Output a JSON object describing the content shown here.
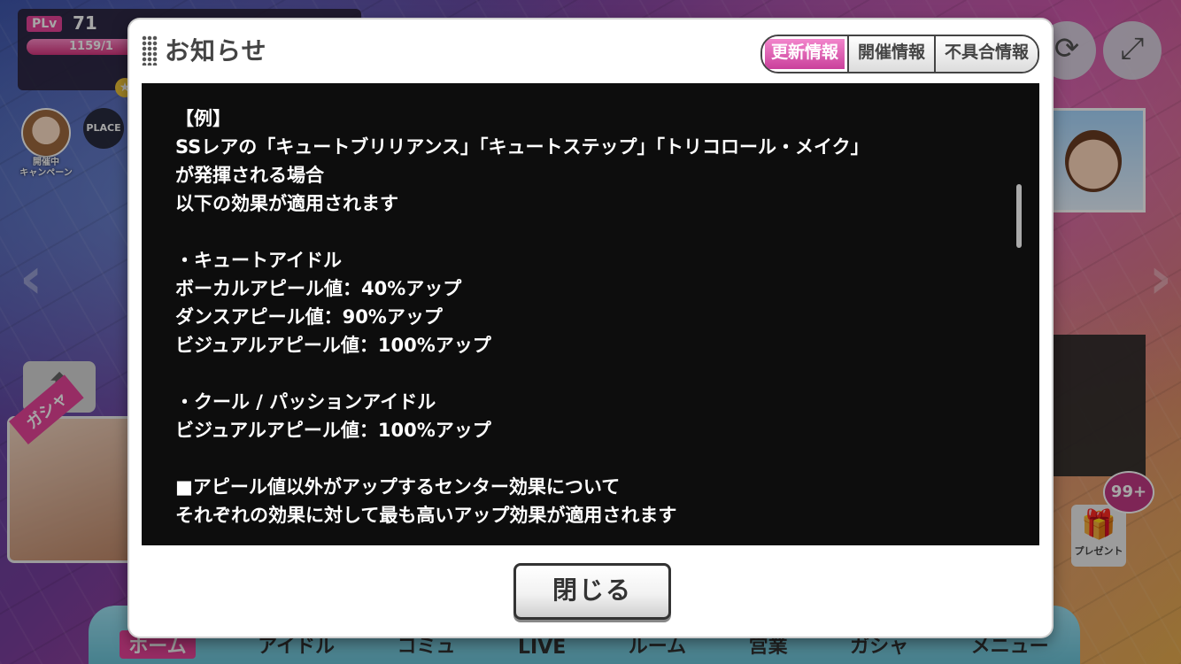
{
  "background": {
    "player_level_badge": "PLv",
    "player_level": "71",
    "exp_text": "1159/1",
    "exp_progress": 0.9,
    "campaign_label": "開催中\nキャンペーン",
    "place_label": "PLACE",
    "gacha_label": "ガシャ",
    "present_label": "プレゼント",
    "present_badge": "99+",
    "footer": [
      "ホーム",
      "アイドル",
      "コミュ",
      "LIVE",
      "ルーム",
      "営業",
      "ガシャ",
      "メニュー"
    ]
  },
  "modal": {
    "title": "お知らせ",
    "tabs": [
      {
        "label": "更新情報",
        "active": true
      },
      {
        "label": "開催情報",
        "active": false
      },
      {
        "label": "不具合情報",
        "active": false
      }
    ],
    "content_lines": [
      "【例】",
      "SSレアの「キュートブリリアンス」「キュートステップ」「トリコロール・メイク」",
      "が発揮される場合",
      "以下の効果が適用されます",
      "",
      "・キュートアイドル",
      "ボーカルアピール値：40%アップ",
      "ダンスアピール値：90%アップ",
      "ビジュアルアピール値：100%アップ",
      "",
      "・クール / パッションアイドル",
      "ビジュアルアピール値：100%アップ",
      "",
      "■アピール値以外がアップするセンター効果について",
      "それぞれの効果に対して最も高いアップ効果が適用されます"
    ],
    "close_label": "閉じる"
  },
  "colors": {
    "accent_pink": "#e8449a",
    "content_bg": "#0d0d0d"
  }
}
